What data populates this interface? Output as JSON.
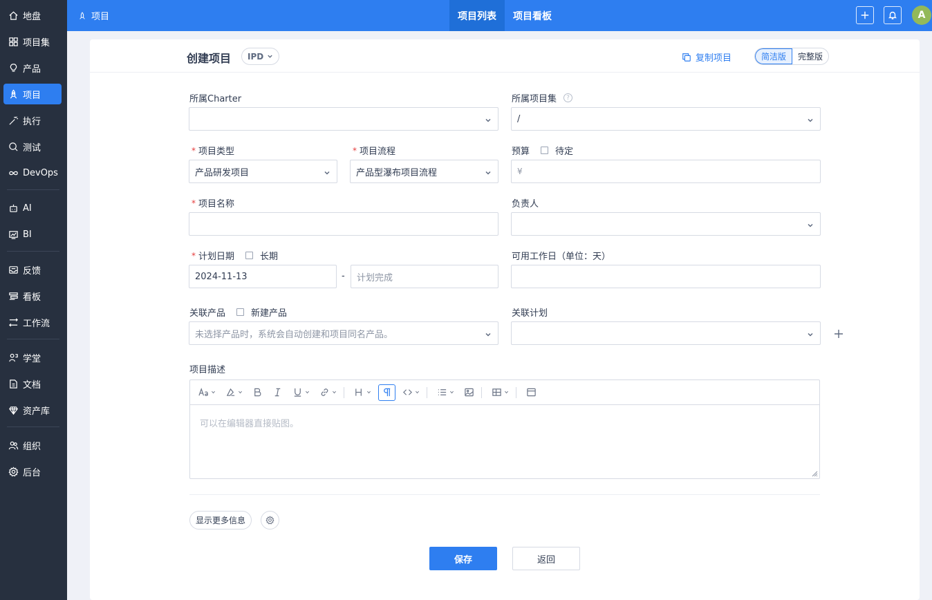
{
  "sidebar": {
    "items": [
      {
        "label": "地盘",
        "icon": "home-icon"
      },
      {
        "label": "项目集",
        "icon": "grid-icon"
      },
      {
        "label": "产品",
        "icon": "lightbulb-icon"
      },
      {
        "label": "项目",
        "icon": "rocket-icon",
        "active": true
      },
      {
        "label": "执行",
        "icon": "wand-icon"
      },
      {
        "label": "测试",
        "icon": "search-icon"
      },
      {
        "label": "DevOps",
        "icon": "infinity-icon"
      },
      {
        "label": "AI",
        "icon": "robot-icon"
      },
      {
        "label": "BI",
        "icon": "chart-icon"
      },
      {
        "label": "反馈",
        "icon": "inbox-icon"
      },
      {
        "label": "看板",
        "icon": "kanban-icon"
      },
      {
        "label": "工作流",
        "icon": "workflow-icon"
      },
      {
        "label": "学堂",
        "icon": "school-icon"
      },
      {
        "label": "文档",
        "icon": "document-icon"
      },
      {
        "label": "资产库",
        "icon": "diamond-icon"
      },
      {
        "label": "组织",
        "icon": "users-icon"
      },
      {
        "label": "后台",
        "icon": "gear-icon"
      }
    ]
  },
  "topbar": {
    "crumb": "项目",
    "tabs": [
      {
        "label": "项目列表",
        "active": true
      },
      {
        "label": "项目看板"
      }
    ],
    "avatar": "A"
  },
  "header": {
    "title": "创建项目",
    "model": "IPD",
    "copy": "复制项目",
    "versions": [
      "简洁版",
      "完整版"
    ]
  },
  "form": {
    "charter": {
      "label": "所属Charter",
      "value": ""
    },
    "program": {
      "label": "所属项目集",
      "value": "/"
    },
    "type": {
      "label": "项目类型",
      "value": "产品研发项目"
    },
    "flow": {
      "label": "项目流程",
      "value": "产品型瀑布项目流程"
    },
    "budget": {
      "label": "预算",
      "check": "待定",
      "prefix": "¥"
    },
    "name": {
      "label": "项目名称",
      "value": ""
    },
    "owner": {
      "label": "负责人",
      "value": ""
    },
    "date": {
      "label": "计划日期",
      "check": "长期",
      "begin": "2024-11-13",
      "end_placeholder": "计划完成",
      "sep": "-"
    },
    "workdays": {
      "label": "可用工作日（单位：天）",
      "value": ""
    },
    "product": {
      "label": "关联产品",
      "check": "新建产品",
      "placeholder": "未选择产品时，系统会自动创建和项目同名产品。"
    },
    "plan": {
      "label": "关联计划",
      "value": ""
    },
    "desc": {
      "label": "项目描述",
      "placeholder": "可以在编辑器直接贴图。"
    }
  },
  "footer": {
    "more": "显示更多信息",
    "save": "保存",
    "back": "返回"
  },
  "colors": {
    "primary": "#2e7ef0",
    "sidebar": "#27303f",
    "required": "#e53d3d"
  }
}
